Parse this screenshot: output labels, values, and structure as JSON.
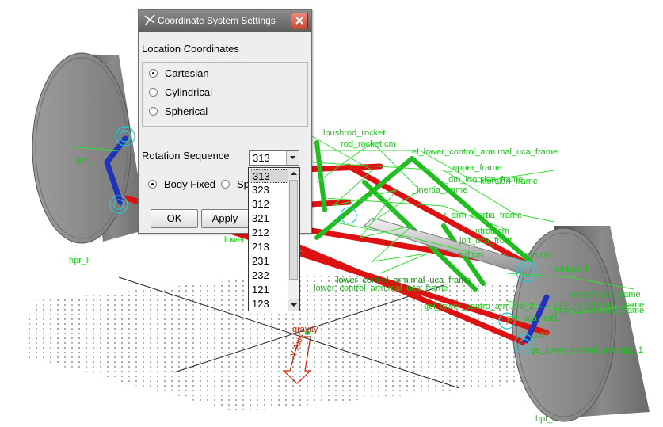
{
  "dialog": {
    "title": "Coordinate System Settings",
    "location_label": "Location Coordinates",
    "coordinate_options": [
      {
        "label": "Cartesian",
        "checked": true
      },
      {
        "label": "Cylindrical",
        "checked": false
      },
      {
        "label": "Spherical",
        "checked": false
      }
    ],
    "rotation_label": "Rotation Sequence",
    "rotation_value": "313",
    "frame_options": [
      {
        "label": "Body Fixed",
        "checked": true
      },
      {
        "label": "Sp",
        "checked": false
      }
    ],
    "ok_label": "OK",
    "apply_label": "Apply"
  },
  "rotation_list": {
    "options": [
      "313",
      "323",
      "312",
      "321",
      "212",
      "213",
      "231",
      "232",
      "121",
      "123"
    ],
    "selected": "313"
  },
  "scene": {
    "labels": [
      "hpr_l",
      "hpl_l",
      "gravity",
      "ger_",
      "el_lower_control_arm.mal_uca_frame",
      "r_arm_inertia_frame",
      "ntrod.cm",
      "jolt_uca_front",
      "prin_upright.uca_frame",
      "ge_lower_control_arm.kp2_1",
      "gel_lower_contro_arm.cra_2",
      "jolt_uca_kpf1",
      "lower_control_arm.mal_uca_frame",
      "_lower_control_arm.mal_uca_frame",
      "lower",
      "_dm_ktorsion_frame",
      "lpushrod_rocket",
      "_ktorsion_frame",
      "prin.cm",
      "upright.uca_frame",
      "prin_upright.uca_frame",
      "_inertia_frame",
      "_upper_frame",
      "trd.cm",
      "tor.kp1_f",
      "_upr",
      "rod_rocket.cm",
      "gel_lower_contro_arm.cra_2"
    ],
    "gravity_tag": "-Y Axis",
    "colors": {
      "frame_red": "#dd1111",
      "arm_green": "#22bb22",
      "link_blue": "#2233bb",
      "label_green": "#11cc11"
    }
  }
}
